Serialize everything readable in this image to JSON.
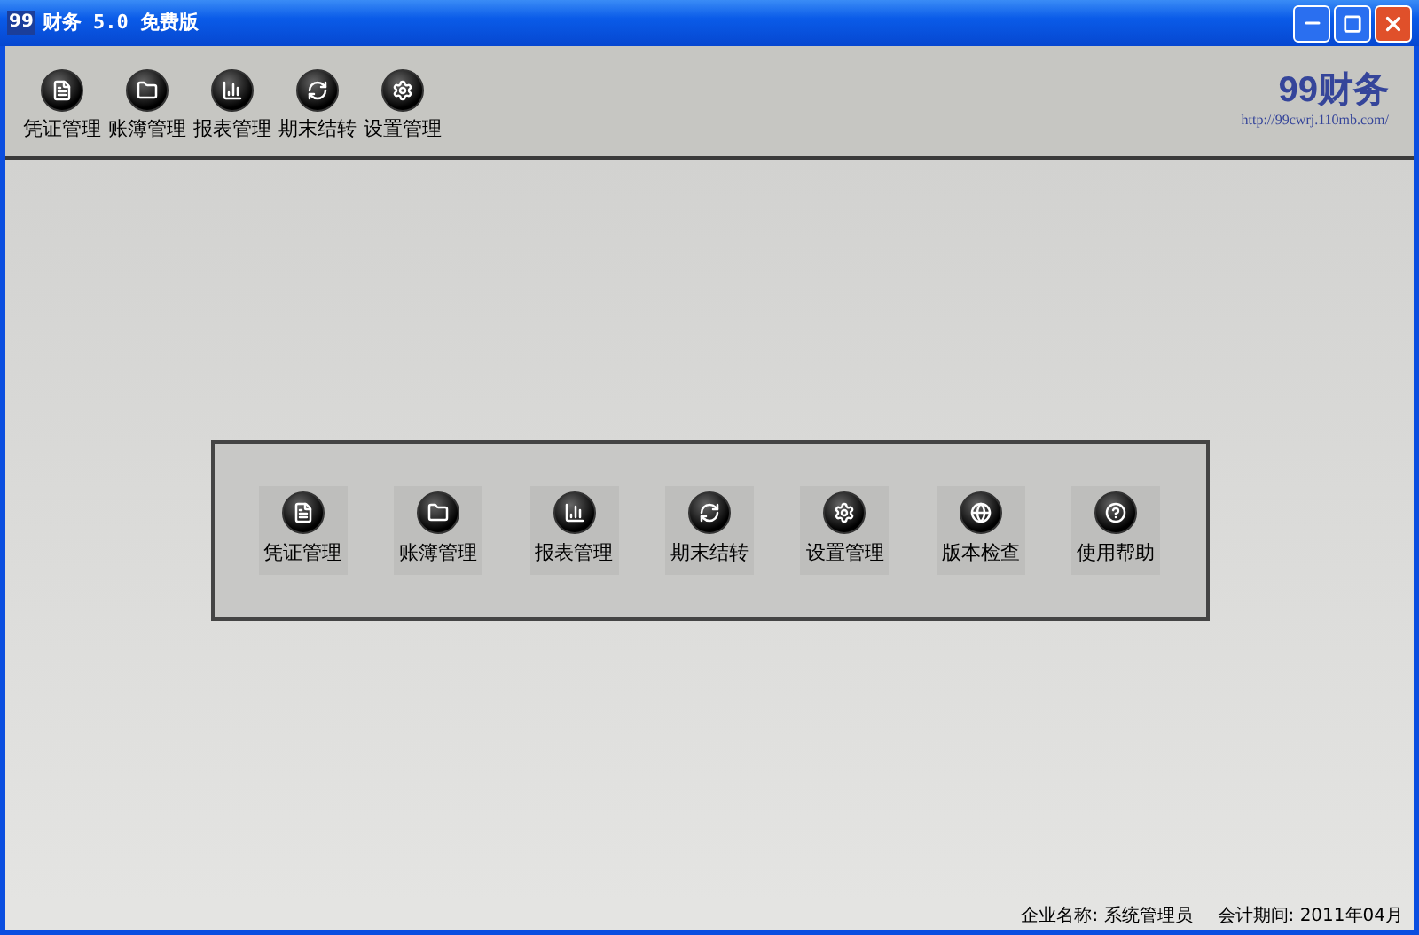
{
  "window": {
    "logo": "99",
    "title": "财务 5.0 免费版"
  },
  "toolbar": [
    {
      "kind": "voucher",
      "label": "凭证管理"
    },
    {
      "kind": "ledger",
      "label": "账簿管理"
    },
    {
      "kind": "report",
      "label": "报表管理"
    },
    {
      "kind": "closing",
      "label": "期末结转"
    },
    {
      "kind": "settings",
      "label": "设置管理"
    }
  ],
  "brand": {
    "name": "99财务",
    "url": "http://99cwrj.110mb.com/"
  },
  "panel": [
    {
      "kind": "voucher",
      "label": "凭证管理"
    },
    {
      "kind": "ledger",
      "label": "账簿管理"
    },
    {
      "kind": "report",
      "label": "报表管理"
    },
    {
      "kind": "closing",
      "label": "期末结转"
    },
    {
      "kind": "settings",
      "label": "设置管理"
    },
    {
      "kind": "version",
      "label": "版本检查"
    },
    {
      "kind": "help",
      "label": "使用帮助"
    }
  ],
  "status_bar": {
    "company": "企业名称: 系统管理员",
    "period": "会计期间: 2011年04月"
  }
}
